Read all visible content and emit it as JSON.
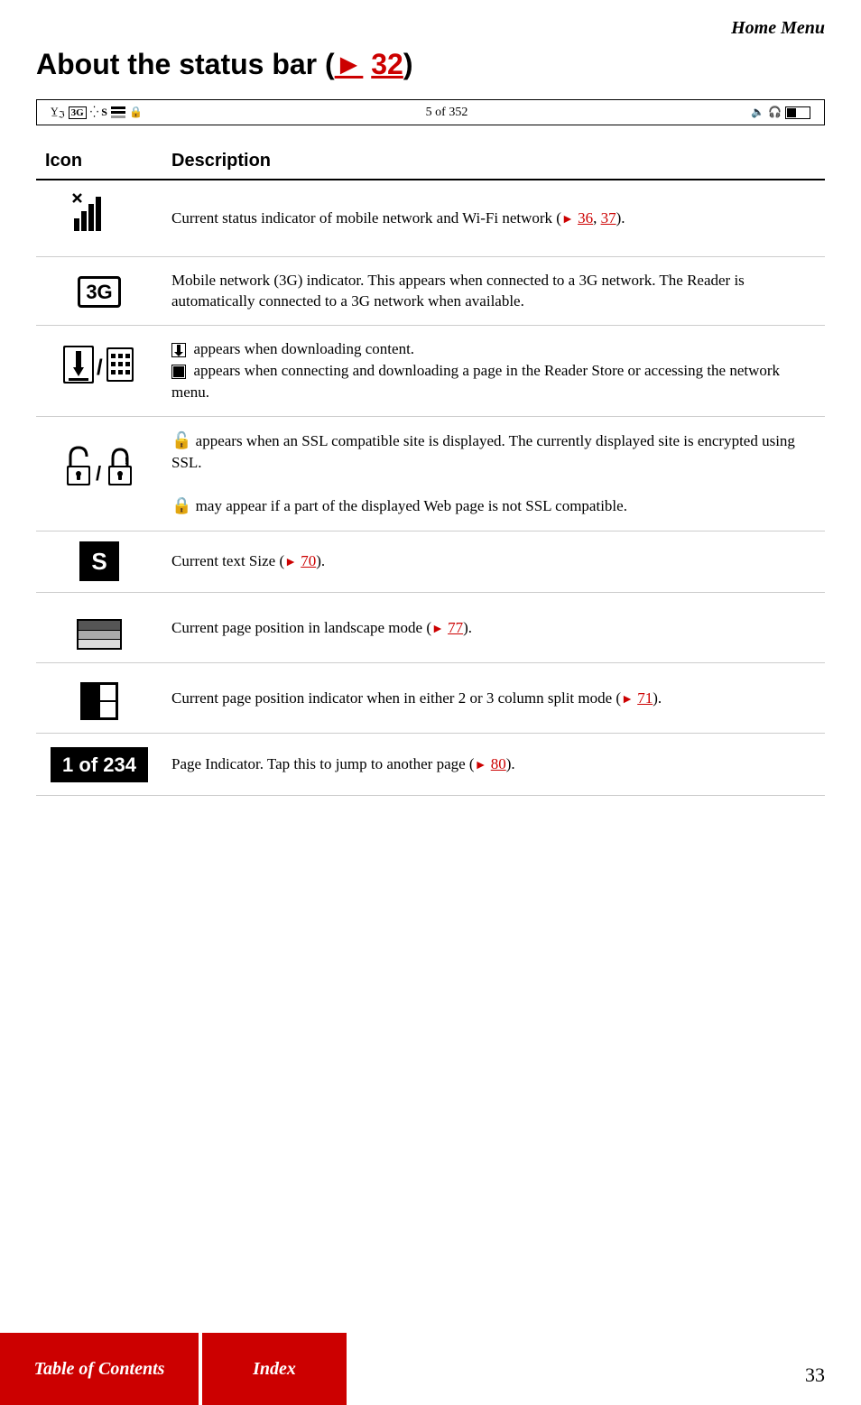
{
  "header": {
    "home_menu_label": "Home Menu"
  },
  "page_title": {
    "text_before": "About the status bar (",
    "arrow": "▶",
    "link_number": "32",
    "text_after": ")"
  },
  "status_bar_demo": {
    "center_text": "5 of 352"
  },
  "table": {
    "col_icon_header": "Icon",
    "col_desc_header": "Description",
    "rows": [
      {
        "icon_label": "Signal/WiFi",
        "description": "Current status indicator of mobile network and Wi-Fi network (▶ 36, 37).",
        "ref1": "36",
        "ref2": "37"
      },
      {
        "icon_label": "3G",
        "description": "Mobile network (3G) indicator. This appears when connected to a 3G network. The Reader is automatically connected to a 3G network when available."
      },
      {
        "icon_label": "Download/Connect",
        "description_part1": "▪ appears when downloading content.",
        "description_part2": "▪ appears when connecting and downloading a page in the Reader Store or accessing the network menu."
      },
      {
        "icon_label": "Lock",
        "description_part1": "🔓 appears when an SSL compatible site is displayed. The currently displayed site is encrypted using SSL.",
        "description_part2": "🔒 may appear if a part of the displayed Web page is not SSL compatible."
      },
      {
        "icon_label": "S",
        "description": "Current text Size (▶ 70).",
        "ref1": "70"
      },
      {
        "icon_label": "Landscape",
        "description": "Current page position in landscape mode (▶ 77).",
        "ref1": "77"
      },
      {
        "icon_label": "Grid",
        "description": "Current page position indicator when in either 2 or 3 column split mode (▶ 71).",
        "ref1": "71"
      },
      {
        "icon_label": "1 of 234",
        "description": "Page Indicator. Tap this to jump to another page (▶ 80).",
        "ref1": "80"
      }
    ]
  },
  "footer": {
    "toc_label": "Table of Contents",
    "index_label": "Index",
    "page_number": "33"
  }
}
